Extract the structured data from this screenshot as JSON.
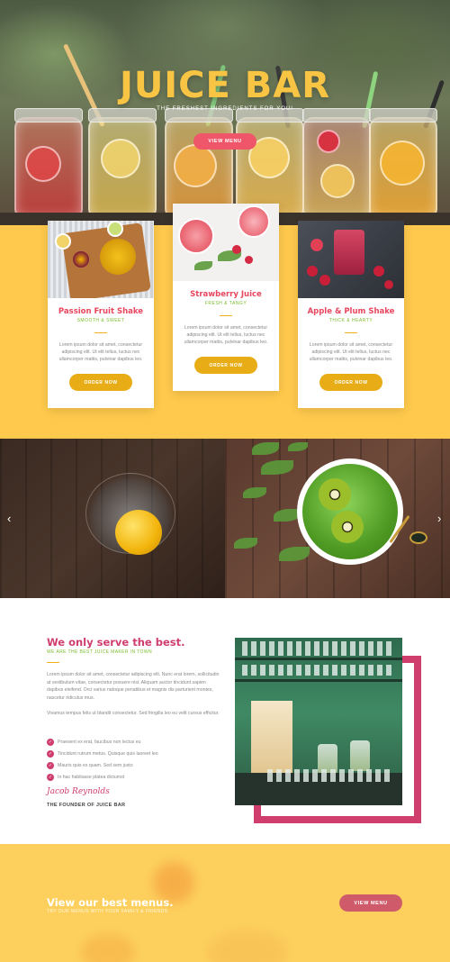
{
  "hero": {
    "title": "JUICE BAR",
    "subtitle": "THE FRESHEST INGREDIENTS FOR YOU!",
    "button_label": "VIEW MENU"
  },
  "cards": [
    {
      "title": "Passion Fruit Shake",
      "subtitle": "SMOOTH & SWEET",
      "text": "Lorem ipsum dolor sit amet, consectetur adipiscing elit. Ut elit tellus, luctus nec ullamcorper mattis, pulvinar dapibus leo.",
      "button_label": "ORDER NOW"
    },
    {
      "title": "Strawberry Juice",
      "subtitle": "FRESH & TANGY",
      "text": "Lorem ipsum dolor sit amet, consectetur adipiscing elit. Ut elit tellus, luctus nec ullamcorper mattis, pulvinar dapibus leo.",
      "button_label": "ORDER NOW"
    },
    {
      "title": "Apple & Plum Shake",
      "subtitle": "THICK & HEARTY",
      "text": "Lorem ipsum dolor sit amet, consectetur adipiscing elit. Ut elit tellus, luctus nec ullamcorper mattis, pulvinar dapibus leo.",
      "button_label": "ORDER NOW"
    }
  ],
  "slider": {
    "prev_icon": "‹",
    "next_icon": "›"
  },
  "about": {
    "title": "We only serve the best.",
    "subtitle": "WE ARE THE BEST JUICE MAKER IN TOWN",
    "paragraph1": "Lorem ipsum dolor sit amet, consectetur adipiscing elit. Nunc erat lorem, sollicitudin at vestibulum vitae, consectetur posuere nisi. Aliquam auctor tincidunt sapien dapibus eleifend. Orci varius natoque penatibus et magnis dis parturient montes, nascetur ridiculus mus.",
    "paragraph2": "Vivamus tempus felis ut blandit consectetur. Sed fringilla leo eu velit cursus efficitur.",
    "checklist": [
      "Praesent ex erat, faucibus non lectus eu",
      "Tincidunt rutrum metus. Quisque quis laoreet leo",
      "Mauris quis ex quam. Sed sem justo",
      "In hac habitasse platea dictumst"
    ],
    "signature": "Jacob Reynolds",
    "founder_label": "THE FOUNDER OF JUICE BAR"
  },
  "cta": {
    "title": "View our best menus.",
    "subtitle": "TRY OUR MENUS WITH YOUR FAMILY & FRIENDS",
    "button_label": "VIEW MENU"
  },
  "colors": {
    "brand_yellow": "#fec94c",
    "title_yellow": "#f7c444",
    "accent_pink": "#cf3e6d",
    "card_title_red": "#e8465e",
    "subtitle_green": "#7cbb2f",
    "button_gold": "#e8ad16",
    "hero_button": "#f0566a"
  },
  "icons": {
    "check": "check-circle-icon",
    "prev": "chevron-left-icon",
    "next": "chevron-right-icon"
  }
}
